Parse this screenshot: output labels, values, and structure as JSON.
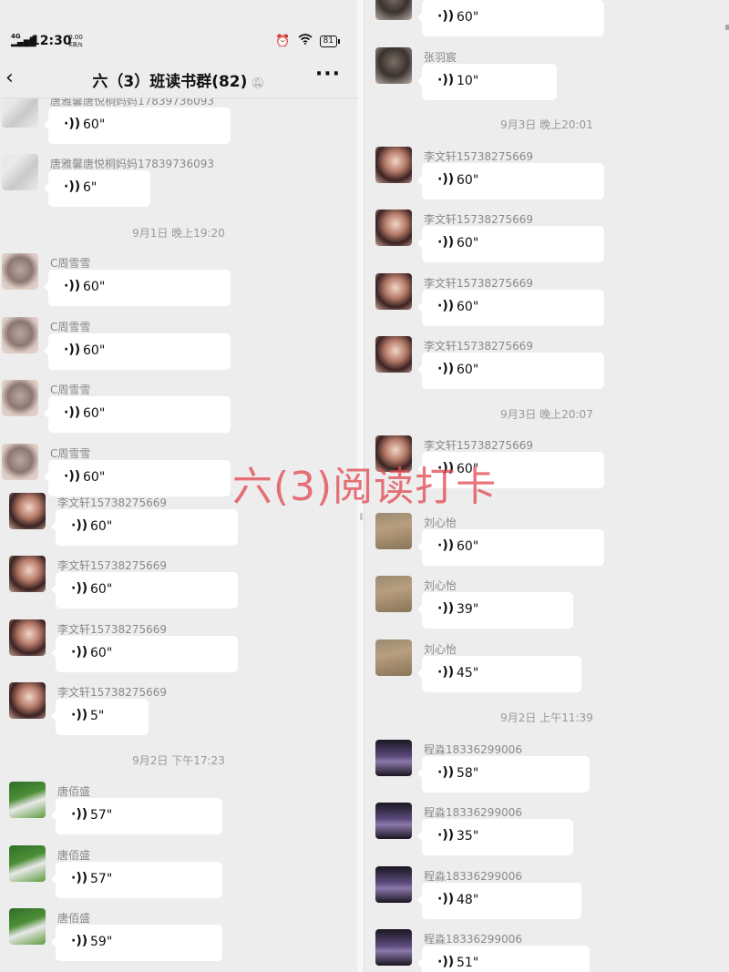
{
  "left": {
    "status": {
      "network": "4G HD",
      "time": "12:30",
      "speed_value": "0.00",
      "speed_unit": "KB/s",
      "battery": "81"
    },
    "header": {
      "title": "六（3）班读书群(82)",
      "back_icon": "chevron-left-icon",
      "mute_icon": "mute-bell-icon",
      "more_icon": "more-icon"
    },
    "messages": [
      {
        "sender": "唐雅馨唐悦桐妈妈17839736093",
        "duration": "60\"",
        "avatar": "tang"
      },
      {
        "sender": "唐雅馨唐悦桐妈妈17839736093",
        "duration": "6\"",
        "avatar": "tang"
      },
      {
        "time": "9月1日 晚上19:20"
      },
      {
        "sender": "C周雪雪",
        "duration": "60\"",
        "avatar": "zhou"
      },
      {
        "sender": "C周雪雪",
        "duration": "60\"",
        "avatar": "zhou"
      },
      {
        "sender": "C周雪雪",
        "duration": "60\"",
        "avatar": "zhou"
      },
      {
        "sender": "C周雪雪",
        "duration": "60\"",
        "avatar": "zhou"
      },
      {
        "sender": "李文轩15738275669",
        "duration": "60\"",
        "avatar": "li"
      },
      {
        "sender": "李文轩15738275669",
        "duration": "60\"",
        "avatar": "li"
      },
      {
        "sender": "李文轩15738275669",
        "duration": "60\"",
        "avatar": "li"
      },
      {
        "sender": "李文轩15738275669",
        "duration": "5\"",
        "avatar": "li"
      },
      {
        "time": "9月2日 下午17:23"
      },
      {
        "sender": "唐佰盛",
        "duration": "57\"",
        "avatar": "tbs"
      },
      {
        "sender": "唐佰盛",
        "duration": "57\"",
        "avatar": "tbs"
      },
      {
        "sender": "唐佰盛",
        "duration": "59\"",
        "avatar": "tbs"
      }
    ]
  },
  "right": {
    "messages": [
      {
        "sender": "",
        "duration": "60\"",
        "avatar": "zhang"
      },
      {
        "sender": "张羽宸",
        "duration": "10\"",
        "avatar": "zhang"
      },
      {
        "time": "9月3日 晚上20:01"
      },
      {
        "sender": "李文轩15738275669",
        "duration": "60\"",
        "avatar": "li"
      },
      {
        "sender": "李文轩15738275669",
        "duration": "60\"",
        "avatar": "li"
      },
      {
        "sender": "李文轩15738275669",
        "duration": "60\"",
        "avatar": "li"
      },
      {
        "sender": "李文轩15738275669",
        "duration": "60\"",
        "avatar": "li"
      },
      {
        "time": "9月3日 晚上20:07"
      },
      {
        "sender": "李文轩15738275669",
        "duration": "60\"",
        "avatar": "li"
      },
      {
        "sender": "刘心怡",
        "duration": "60\"",
        "avatar": "liu"
      },
      {
        "sender": "刘心怡",
        "duration": "39\"",
        "avatar": "liu"
      },
      {
        "sender": "刘心怡",
        "duration": "45\"",
        "avatar": "liu"
      },
      {
        "time": "9月2日 上午11:39"
      },
      {
        "sender": "程淼18336299006",
        "duration": "58\"",
        "avatar": "cheng"
      },
      {
        "sender": "程淼18336299006",
        "duration": "35\"",
        "avatar": "cheng"
      },
      {
        "sender": "程淼18336299006",
        "duration": "48\"",
        "avatar": "cheng"
      },
      {
        "sender": "程淼18336299006",
        "duration": "51\"",
        "avatar": "cheng"
      }
    ]
  },
  "overlay_text": "六(3)阅读打卡",
  "icons": {
    "voice": "voice-wave-icon",
    "alarm": "alarm-icon",
    "wifi": "wifi-icon",
    "battery": "battery-icon"
  }
}
